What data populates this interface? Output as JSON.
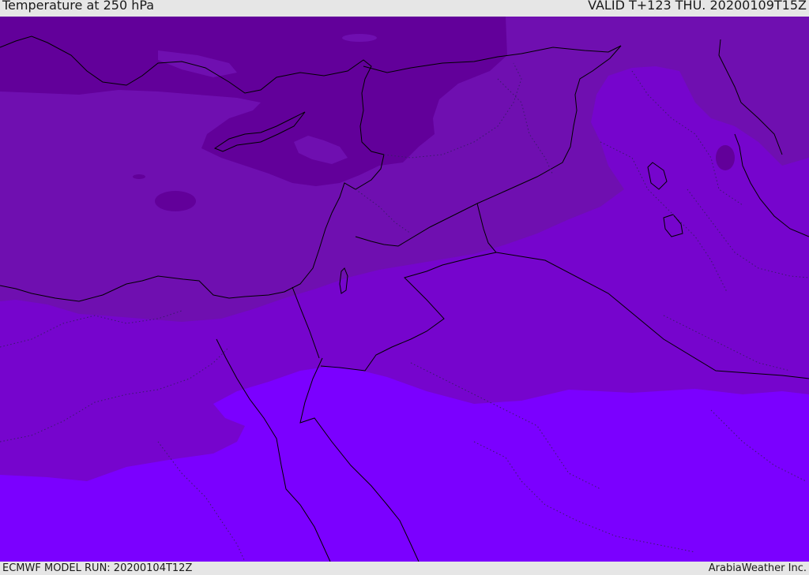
{
  "header": {
    "title": "Temperature at 250 hPa",
    "valid": "VALID T+123 THU. 20200109T15Z"
  },
  "footer": {
    "model_run": "ECMWF MODEL RUN: 20200104T12Z",
    "credit": "ArabiaWeather Inc."
  },
  "map": {
    "colors": {
      "band_coldest": "#62009a",
      "band_cold": "#6f0fb0",
      "band_mid": "#7605cd",
      "band_warm": "#7b00ff",
      "coast": "#000000",
      "border_dotted": "#3a1a6a"
    }
  }
}
